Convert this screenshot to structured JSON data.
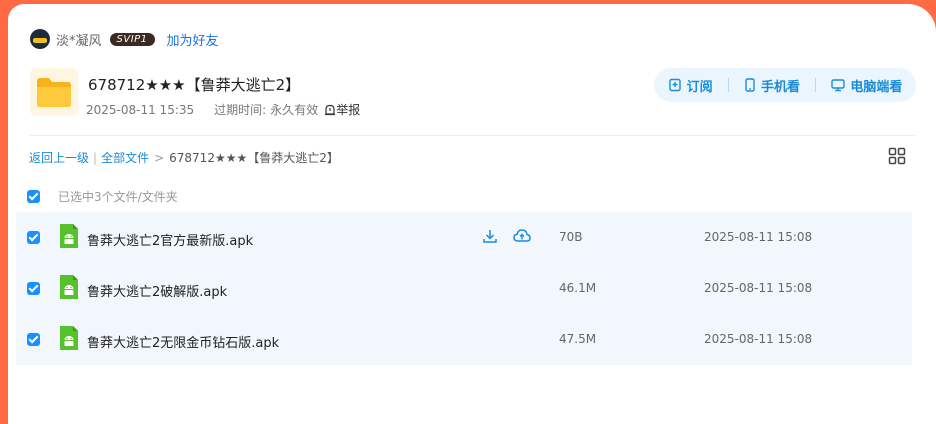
{
  "user": {
    "name": "淡*凝风",
    "vip_badge": "SVIP1",
    "add_friend": "加为好友"
  },
  "share": {
    "title": "678712★★★【鲁莽大逃亡2】",
    "date": "2025-08-11 15:35",
    "expiry_label": "过期时间:",
    "expiry_value": "永久有效",
    "report": "举报"
  },
  "actions": {
    "subscribe": "订阅",
    "mobile": "手机看",
    "desktop": "电脑端看"
  },
  "breadcrumb": {
    "back": "返回上一级",
    "all_files": "全部文件",
    "current": "678712★★★【鲁莽大逃亡2】"
  },
  "selection": {
    "text": "已选中3个文件/文件夹"
  },
  "files": [
    {
      "name": "鲁莽大逃亡2官方最新版.apk",
      "size": "70B",
      "time": "2025-08-11 15:08",
      "checked": true
    },
    {
      "name": "鲁莽大逃亡2破解版.apk",
      "size": "46.1M",
      "time": "2025-08-11 15:08",
      "checked": true
    },
    {
      "name": "鲁莽大逃亡2无限金币钻石版.apk",
      "size": "47.5M",
      "time": "2025-08-11 15:08",
      "checked": true
    }
  ],
  "colors": {
    "accent": "#1a8cd8",
    "checkbox": "#1890ff",
    "row_bg": "#f1f7fd",
    "frame": "#ff6a45",
    "android": "#56c02d"
  },
  "icons": [
    "folder-icon",
    "report-icon",
    "bookmark-icon",
    "phone-icon",
    "monitor-icon",
    "grid-view-icon",
    "android-icon",
    "download-icon",
    "cloud-save-icon"
  ]
}
